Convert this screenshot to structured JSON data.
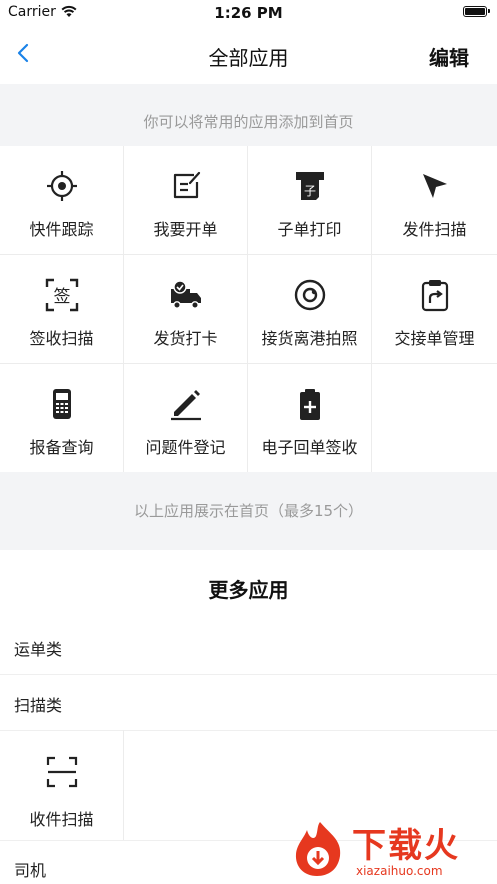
{
  "status_bar": {
    "carrier": "Carrier",
    "time": "1:26 PM"
  },
  "nav": {
    "title": "全部应用",
    "edit_label": "编辑"
  },
  "hint": "你可以将常用的应用添加到首页",
  "apps": [
    {
      "label": "快件跟踪",
      "icon": "crosshair-icon"
    },
    {
      "label": "我要开单",
      "icon": "edit-form-icon"
    },
    {
      "label": "子单打印",
      "icon": "printer-icon"
    },
    {
      "label": "发件扫描",
      "icon": "send-arrow-icon"
    },
    {
      "label": "签收扫描",
      "icon": "sign-scan-icon"
    },
    {
      "label": "发货打卡",
      "icon": "truck-icon"
    },
    {
      "label": "接货离港拍照",
      "icon": "camera-icon"
    },
    {
      "label": "交接单管理",
      "icon": "clipboard-icon"
    },
    {
      "label": "报备查询",
      "icon": "handheld-device-icon"
    },
    {
      "label": "问题件登记",
      "icon": "pencil-icon"
    },
    {
      "label": "电子回单签收",
      "icon": "receipt-plus-icon"
    }
  ],
  "footer_hint": "以上应用展示在首页（最多15个）",
  "more": {
    "title": "更多应用",
    "categories": [
      "运单类",
      "扫描类",
      "司机"
    ],
    "scan_apps": [
      {
        "label": "收件扫描",
        "icon": "scan-frame-icon"
      }
    ]
  },
  "watermark": {
    "text": "下载火",
    "url": "xiazaihuo.com"
  },
  "colors": {
    "accent": "#1a82e8",
    "divider_bg": "#f3f4f6",
    "watermark": "#e6381f"
  }
}
